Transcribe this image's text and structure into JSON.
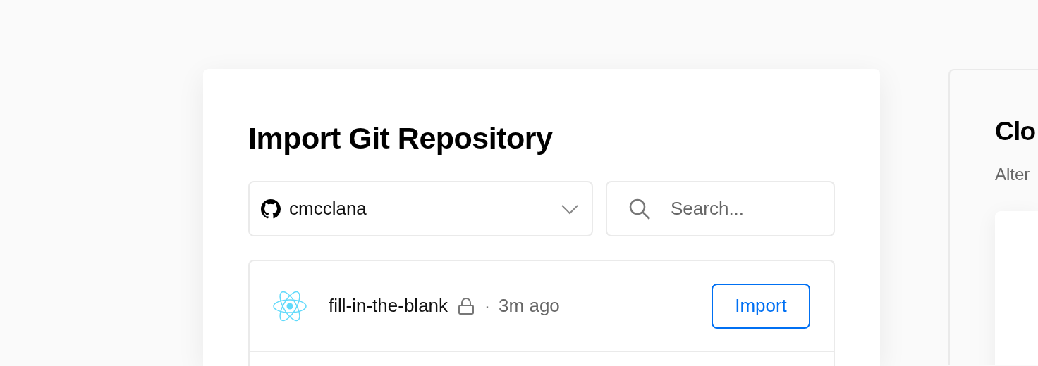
{
  "import_card": {
    "title": "Import Git Repository",
    "account_select": {
      "value": "cmcclana"
    },
    "search": {
      "placeholder": "Search..."
    },
    "repositories": [
      {
        "name": "fill-in-the-blank",
        "private": true,
        "separator": "·",
        "updated": "3m ago",
        "button": "Import"
      }
    ]
  },
  "clone_card": {
    "title": "Clo",
    "subtitle": "Alter"
  }
}
